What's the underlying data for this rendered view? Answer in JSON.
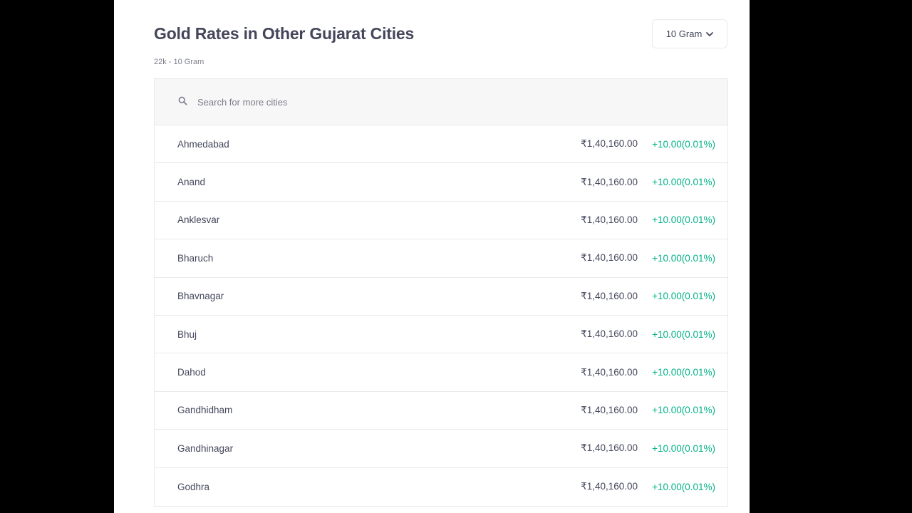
{
  "header": {
    "title": "Gold Rates in Other Gujarat Cities",
    "subtitle": "22k - 10 Gram"
  },
  "unit_selector": {
    "value": "10 Gram",
    "icon": "chevron-down-icon"
  },
  "search": {
    "placeholder": "Search for more cities",
    "icon": "search-icon"
  },
  "colors": {
    "positive_change": "#00b386",
    "text": "#44475b",
    "muted": "#7c7e8c"
  },
  "rows": [
    {
      "city": "Ahmedabad",
      "price": "₹1,40,160.00",
      "change": "+10.00(0.01%)"
    },
    {
      "city": "Anand",
      "price": "₹1,40,160.00",
      "change": "+10.00(0.01%)"
    },
    {
      "city": "Anklesvar",
      "price": "₹1,40,160.00",
      "change": "+10.00(0.01%)"
    },
    {
      "city": "Bharuch",
      "price": "₹1,40,160.00",
      "change": "+10.00(0.01%)"
    },
    {
      "city": "Bhavnagar",
      "price": "₹1,40,160.00",
      "change": "+10.00(0.01%)"
    },
    {
      "city": "Bhuj",
      "price": "₹1,40,160.00",
      "change": "+10.00(0.01%)"
    },
    {
      "city": "Dahod",
      "price": "₹1,40,160.00",
      "change": "+10.00(0.01%)"
    },
    {
      "city": "Gandhidham",
      "price": "₹1,40,160.00",
      "change": "+10.00(0.01%)"
    },
    {
      "city": "Gandhinagar",
      "price": "₹1,40,160.00",
      "change": "+10.00(0.01%)"
    },
    {
      "city": "Godhra",
      "price": "₹1,40,160.00",
      "change": "+10.00(0.01%)"
    }
  ]
}
